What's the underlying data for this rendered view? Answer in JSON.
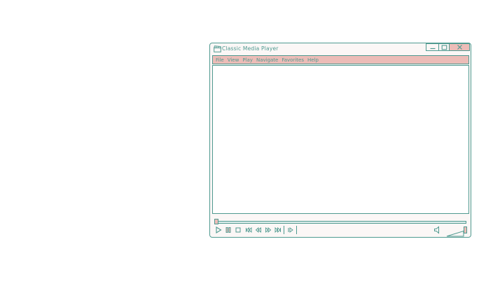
{
  "window": {
    "title": "Classic Media Player",
    "controls": [
      "minimize-icon",
      "maximize-icon",
      "close-icon"
    ]
  },
  "menu": {
    "items": [
      "File",
      "View",
      "Play",
      "Navigate",
      "Favorites",
      "Help"
    ]
  },
  "seek": {
    "progress": 0.0
  },
  "transport": {
    "buttons": [
      "play-icon",
      "pause-icon",
      "stop-icon",
      "previous-icon",
      "rewind-icon",
      "fast-forward-icon",
      "next-icon",
      "step-forward-icon"
    ]
  },
  "volume": {
    "icon": "speaker-icon",
    "level": 1.0
  },
  "colors": {
    "border": "#4f9a90",
    "accent": "#ecbcb7",
    "background": "#fbf7f6"
  }
}
